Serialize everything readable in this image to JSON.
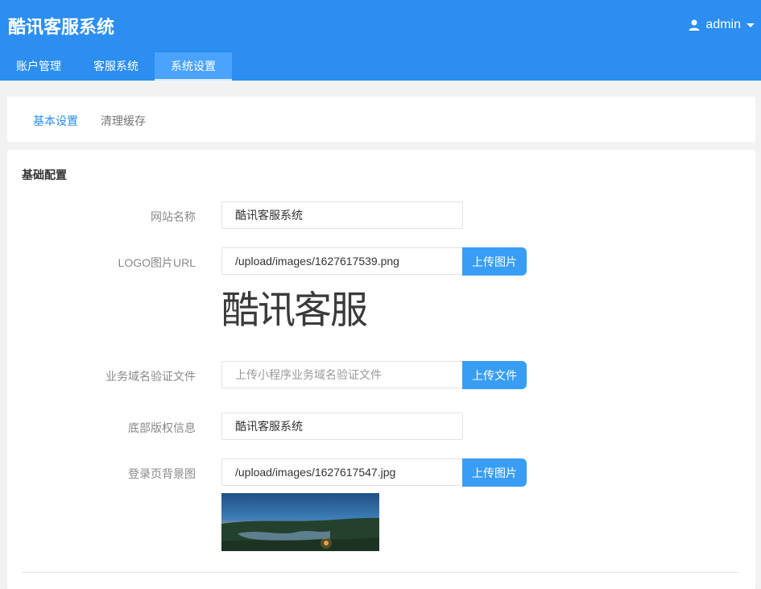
{
  "header": {
    "app_title": "酷讯客服系统",
    "user_name": "admin",
    "nav": [
      "账户管理",
      "客服系统",
      "系统设置"
    ],
    "active_nav_index": 2,
    "colors": {
      "header_bg": "#2b8ef0",
      "active_tab_bg": "#4aa3ff"
    }
  },
  "subtabs": {
    "items": [
      "基本设置",
      "清理缓存"
    ],
    "active_index": 0
  },
  "form": {
    "section_title": "基础配置",
    "site_name": {
      "label": "网站名称",
      "value": "酷讯客服系统"
    },
    "logo_url": {
      "label": "LOGO图片URL",
      "value": "/upload/images/1627617539.png",
      "button_label": "上传图片",
      "preview_text": "酷讯客服"
    },
    "domain_verify": {
      "label": "业务域名验证文件",
      "value": "",
      "placeholder": "上传小程序业务域名验证文件",
      "button_label": "上传文件"
    },
    "copyright": {
      "label": "底部版权信息",
      "value": "酷讯客服系统"
    },
    "login_bg": {
      "label": "登录页背景图",
      "value": "/upload/images/1627617547.jpg",
      "button_label": "上传图片"
    }
  }
}
